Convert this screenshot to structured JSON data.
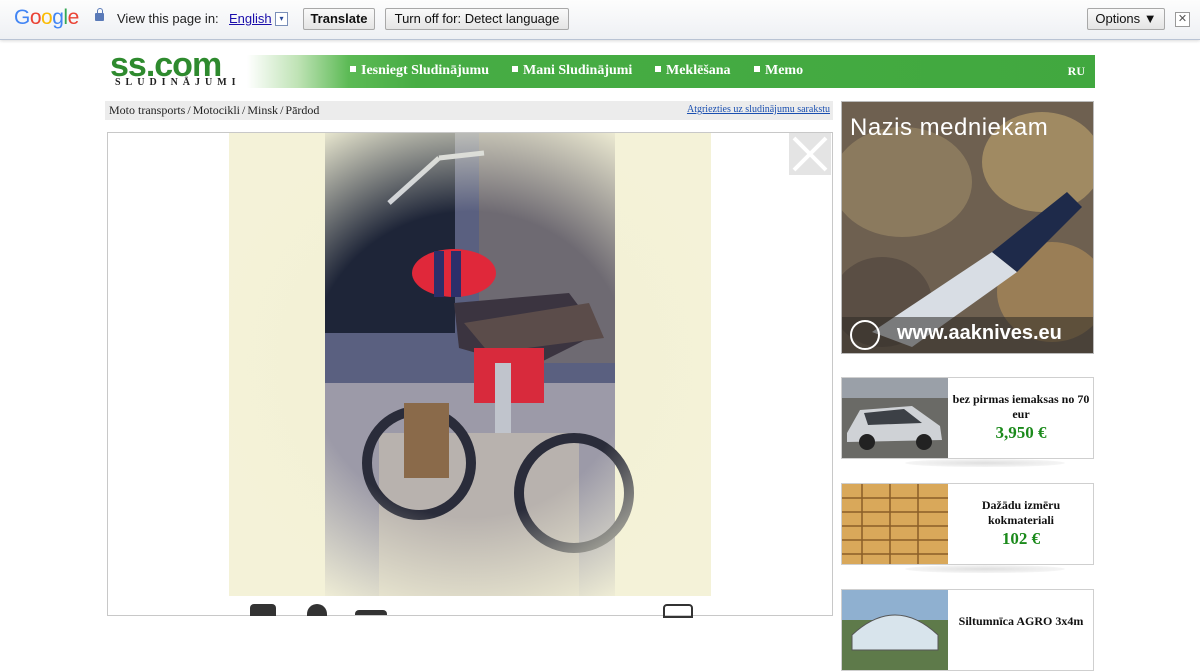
{
  "translate_bar": {
    "logo": "Google",
    "prompt": "View this page in:",
    "language": "English",
    "dropdown_glyph": "▾",
    "translate_label": "Translate",
    "turn_off_label": "Turn off for: Detect language",
    "options_label": "Options ▼",
    "close_glyph": "✕"
  },
  "site": {
    "logo": "ss.com",
    "logo_sub": "SLUDINĀJUMI",
    "nav": [
      "Iesniegt Sludinājumu",
      "Mani Sludinājumi",
      "Meklēšana",
      "Memo"
    ],
    "lang": "RU"
  },
  "breadcrumb": {
    "items": [
      "Moto transports",
      "Motocikli",
      "Minsk",
      "Pārdod"
    ],
    "back_link": "Atgriezties uz sludinājumu sarakstu"
  },
  "colors": {
    "nav_green": "#41a83f",
    "price_green": "#1b8a1b",
    "link_blue": "#1a4fb0"
  },
  "ads": {
    "banner": {
      "title": "Nazis medniekam",
      "url": "www.aaknives.eu"
    },
    "cards": [
      {
        "text": "bez pirmas iemaksas no 70 eur",
        "price": "3,950 €"
      },
      {
        "text": "Dažādu izmēru kokmateriali",
        "price": "102 €"
      },
      {
        "text": "Siltumnīca AGRO 3x4m",
        "price": ""
      }
    ]
  }
}
